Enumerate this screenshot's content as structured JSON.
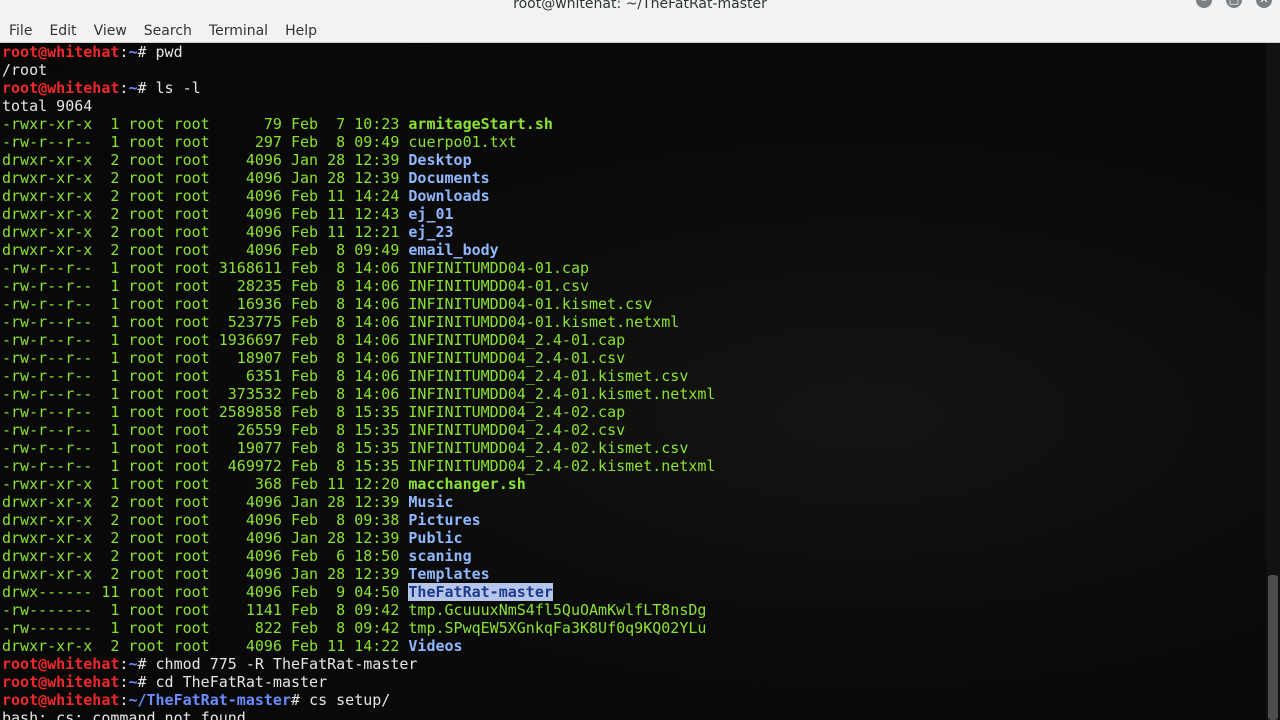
{
  "window": {
    "title": "root@whitehat: ~/TheFatRat-master",
    "minimize_glyph": "–",
    "maximize_glyph": "□",
    "close_glyph": "✕"
  },
  "menu": [
    "File",
    "Edit",
    "View",
    "Search",
    "Terminal",
    "Help"
  ],
  "colors": {
    "prompt_user": "#ef2929",
    "prompt_path": "#6b8cff",
    "directory": "#8fb8ff",
    "executable": "#8ae234",
    "plain_file": "#8ae234",
    "selection_bg": "#b5c6ea"
  },
  "lines": [
    {
      "kind": "prompt",
      "user": "root@whitehat",
      "path": "~",
      "cmd": "pwd"
    },
    {
      "kind": "out",
      "text": "/root"
    },
    {
      "kind": "prompt",
      "user": "root@whitehat",
      "path": "~",
      "cmd": "ls -l"
    },
    {
      "kind": "out",
      "text": "total 9064"
    },
    {
      "kind": "ls",
      "meta": "-rwxr-xr-x  1 root root      79 Feb  7 10:23 ",
      "name": "armitageStart.sh",
      "type": "exec"
    },
    {
      "kind": "ls",
      "meta": "-rw-r--r--  1 root root     297 Feb  8 09:49 ",
      "name": "cuerpo01.txt",
      "type": "file"
    },
    {
      "kind": "ls",
      "meta": "drwxr-xr-x  2 root root    4096 Jan 28 12:39 ",
      "name": "Desktop",
      "type": "dir"
    },
    {
      "kind": "ls",
      "meta": "drwxr-xr-x  2 root root    4096 Jan 28 12:39 ",
      "name": "Documents",
      "type": "dir"
    },
    {
      "kind": "ls",
      "meta": "drwxr-xr-x  2 root root    4096 Feb 11 14:24 ",
      "name": "Downloads",
      "type": "dir"
    },
    {
      "kind": "ls",
      "meta": "drwxr-xr-x  2 root root    4096 Feb 11 12:43 ",
      "name": "ej_01",
      "type": "dir"
    },
    {
      "kind": "ls",
      "meta": "drwxr-xr-x  2 root root    4096 Feb 11 12:21 ",
      "name": "ej_23",
      "type": "dir"
    },
    {
      "kind": "ls",
      "meta": "drwxr-xr-x  2 root root    4096 Feb  8 09:49 ",
      "name": "email_body",
      "type": "dir"
    },
    {
      "kind": "ls",
      "meta": "-rw-r--r--  1 root root 3168611 Feb  8 14:06 ",
      "name": "INFINITUMDD04-01.cap",
      "type": "file"
    },
    {
      "kind": "ls",
      "meta": "-rw-r--r--  1 root root   28235 Feb  8 14:06 ",
      "name": "INFINITUMDD04-01.csv",
      "type": "file"
    },
    {
      "kind": "ls",
      "meta": "-rw-r--r--  1 root root   16936 Feb  8 14:06 ",
      "name": "INFINITUMDD04-01.kismet.csv",
      "type": "file"
    },
    {
      "kind": "ls",
      "meta": "-rw-r--r--  1 root root  523775 Feb  8 14:06 ",
      "name": "INFINITUMDD04-01.kismet.netxml",
      "type": "file"
    },
    {
      "kind": "ls",
      "meta": "-rw-r--r--  1 root root 1936697 Feb  8 14:06 ",
      "name": "INFINITUMDD04_2.4-01.cap",
      "type": "file"
    },
    {
      "kind": "ls",
      "meta": "-rw-r--r--  1 root root   18907 Feb  8 14:06 ",
      "name": "INFINITUMDD04_2.4-01.csv",
      "type": "file"
    },
    {
      "kind": "ls",
      "meta": "-rw-r--r--  1 root root    6351 Feb  8 14:06 ",
      "name": "INFINITUMDD04_2.4-01.kismet.csv",
      "type": "file"
    },
    {
      "kind": "ls",
      "meta": "-rw-r--r--  1 root root  373532 Feb  8 14:06 ",
      "name": "INFINITUMDD04_2.4-01.kismet.netxml",
      "type": "file"
    },
    {
      "kind": "ls",
      "meta": "-rw-r--r--  1 root root 2589858 Feb  8 15:35 ",
      "name": "INFINITUMDD04_2.4-02.cap",
      "type": "file"
    },
    {
      "kind": "ls",
      "meta": "-rw-r--r--  1 root root   26559 Feb  8 15:35 ",
      "name": "INFINITUMDD04_2.4-02.csv",
      "type": "file"
    },
    {
      "kind": "ls",
      "meta": "-rw-r--r--  1 root root   19077 Feb  8 15:35 ",
      "name": "INFINITUMDD04_2.4-02.kismet.csv",
      "type": "file"
    },
    {
      "kind": "ls",
      "meta": "-rw-r--r--  1 root root  469972 Feb  8 15:35 ",
      "name": "INFINITUMDD04_2.4-02.kismet.netxml",
      "type": "file"
    },
    {
      "kind": "ls",
      "meta": "-rwxr-xr-x  1 root root     368 Feb 11 12:20 ",
      "name": "macchanger.sh",
      "type": "exec"
    },
    {
      "kind": "ls",
      "meta": "drwxr-xr-x  2 root root    4096 Jan 28 12:39 ",
      "name": "Music",
      "type": "dir"
    },
    {
      "kind": "ls",
      "meta": "drwxr-xr-x  2 root root    4096 Feb  8 09:38 ",
      "name": "Pictures",
      "type": "dir"
    },
    {
      "kind": "ls",
      "meta": "drwxr-xr-x  2 root root    4096 Jan 28 12:39 ",
      "name": "Public",
      "type": "dir"
    },
    {
      "kind": "ls",
      "meta": "drwxr-xr-x  2 root root    4096 Feb  6 18:50 ",
      "name": "scaning",
      "type": "dir"
    },
    {
      "kind": "ls",
      "meta": "drwxr-xr-x  2 root root    4096 Jan 28 12:39 ",
      "name": "Templates",
      "type": "dir"
    },
    {
      "kind": "ls",
      "meta": "drwx------ 11 root root    4096 Feb  9 04:50 ",
      "name": "TheFatRat-master",
      "type": "selected"
    },
    {
      "kind": "ls",
      "meta": "-rw-------  1 root root    1141 Feb  8 09:42 ",
      "name": "tmp.GcuuuxNmS4fl5QuOAmKwlfLT8nsDg",
      "type": "file"
    },
    {
      "kind": "ls",
      "meta": "-rw-------  1 root root     822 Feb  8 09:42 ",
      "name": "tmp.SPwqEW5XGnkqFa3K8Uf0q9KQ02YLu",
      "type": "file"
    },
    {
      "kind": "ls",
      "meta": "drwxr-xr-x  2 root root    4096 Feb 11 14:22 ",
      "name": "Videos",
      "type": "dir"
    },
    {
      "kind": "prompt",
      "user": "root@whitehat",
      "path": "~",
      "cmd": "chmod 775 -R TheFatRat-master"
    },
    {
      "kind": "prompt",
      "user": "root@whitehat",
      "path": "~",
      "cmd": "cd TheFatRat-master"
    },
    {
      "kind": "prompt",
      "user": "root@whitehat",
      "path": "~/TheFatRat-master",
      "cmd": "cs setup/"
    },
    {
      "kind": "out",
      "text": "bash: cs: command not found"
    }
  ]
}
